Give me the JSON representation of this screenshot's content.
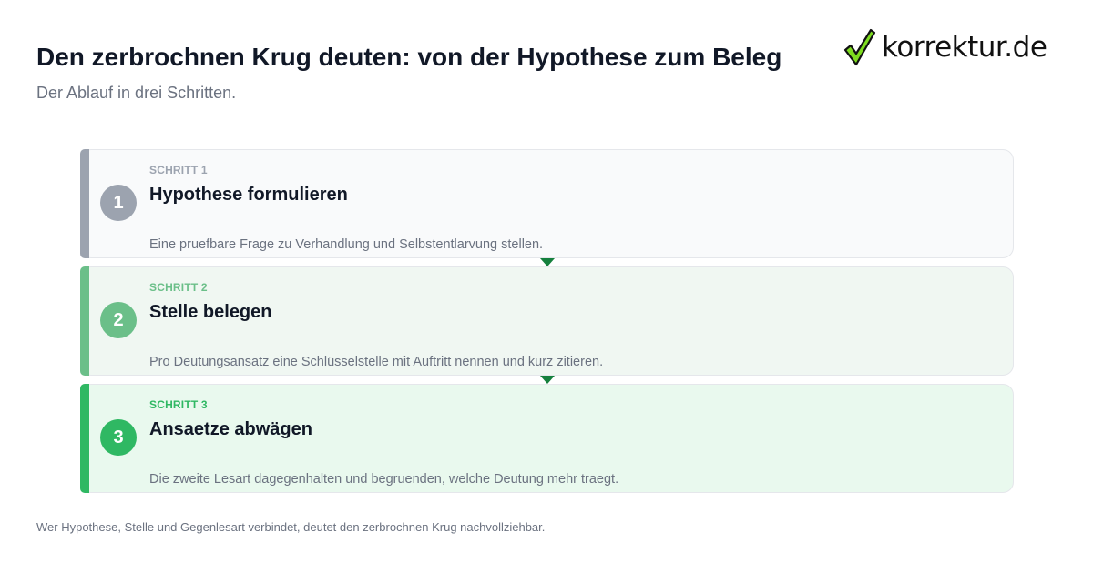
{
  "header": {
    "title": "Den zerbrochnen Krug deuten: von der Hypothese zum Beleg",
    "subtitle": "Der Ablauf in drei Schritten."
  },
  "logo": {
    "text": "korrektur.de",
    "icon": "checkmark-icon",
    "colors": {
      "check_fill": "#7ddc1f",
      "check_stroke": "#111111"
    }
  },
  "steps": [
    {
      "number": "1",
      "kicker": "SCHRITT 1",
      "heading": "Hypothese formulieren",
      "description": "Eine pruefbare Frage zu Verhandlung und Selbstentlarvung stellen.",
      "accent": "#9ca3af"
    },
    {
      "number": "2",
      "kicker": "SCHRITT 2",
      "heading": "Stelle belegen",
      "description": "Pro Deutungsansatz eine Schlüsselstelle mit Auftritt nennen und kurz zitieren.",
      "accent": "#6bbf89"
    },
    {
      "number": "3",
      "kicker": "SCHRITT 3",
      "heading": "Ansaetze abwägen",
      "description": "Die zweite Lesart dagegenhalten und begruenden, welche Deutung mehr traegt.",
      "accent": "#2fb863"
    }
  ],
  "footer": {
    "text": "Wer Hypothese, Stelle und Gegenlesart verbindet, deutet den zerbrochnen Krug nachvollziehbar."
  },
  "colors": {
    "connector_arrow": "#15803d",
    "divider": "#e5e7eb"
  }
}
